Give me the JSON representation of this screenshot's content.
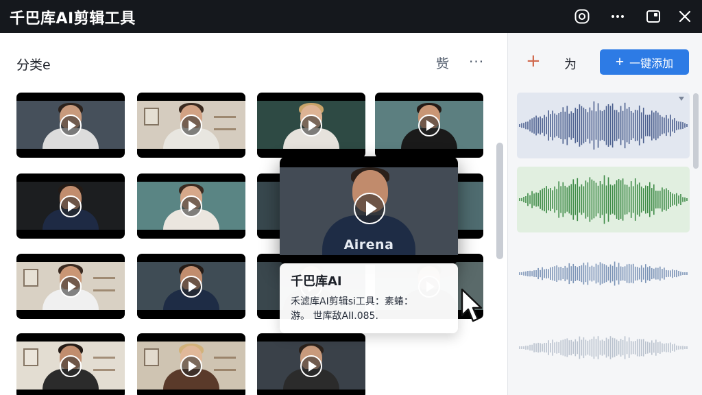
{
  "window": {
    "title": "千巴库AI剪辑工具",
    "controls": [
      "settings-icon",
      "more-icon",
      "restore-icon",
      "close-icon"
    ]
  },
  "library": {
    "category_title": "分类e",
    "header_icon_label": "赀",
    "more_label": "···",
    "thumbnails": [
      {
        "bg": "#46505b",
        "skin": "#c89a7c",
        "hair": "#2c221c",
        "shirt": "#dcdcdc",
        "style": "plain"
      },
      {
        "bg": "#d5ccbf",
        "skin": "#d2a284",
        "hair": "#3a2a20",
        "shirt": "#e8e6e0",
        "style": "room"
      },
      {
        "bg": "#2e4a44",
        "skin": "#ddb394",
        "hair": "#c9a46a",
        "shirt": "#e6e2dc",
        "style": "plain"
      },
      {
        "bg": "#5c7f80",
        "skin": "#c99675",
        "hair": "#241b16",
        "shirt": "#1a1a1a",
        "style": "plain"
      },
      {
        "bg": "#1c1e20",
        "skin": "#c18d6e",
        "hair": "#241b16",
        "shirt": "#1e2a44",
        "style": "plain"
      },
      {
        "bg": "#5a8584",
        "skin": "#d6a88a",
        "hair": "#3a2a20",
        "shirt": "#ebe6df",
        "style": "plain"
      },
      {
        "bg": "#38484e",
        "skin": "#c89a7c",
        "hair": "#2c221c",
        "shirt": "#2a2a2a",
        "style": "plain"
      },
      {
        "bg": "#4f6c70",
        "skin": "#c89a7c",
        "hair": "#2c221c",
        "shirt": "#2a2a2a",
        "style": "plain"
      },
      {
        "bg": "#d9d1c4",
        "skin": "#c99675",
        "hair": "#3a2a20",
        "shirt": "#f0f0f0",
        "style": "room"
      },
      {
        "bg": "#3f4c55",
        "skin": "#c18d6e",
        "hair": "#241b16",
        "shirt": "#1e2c45",
        "style": "plain"
      },
      {
        "bg": "#3a474d",
        "skin": "#c89a7c",
        "hair": "#2c221c",
        "shirt": "#2a2a2a",
        "style": "plain"
      },
      {
        "bg": "#5a6a6a",
        "skin": "#c89a7c",
        "hair": "#2c221c",
        "shirt": "#2a2a2a",
        "style": "plain"
      },
      {
        "bg": "#e3ddd2",
        "skin": "#c18d6e",
        "hair": "#241b16",
        "shirt": "#2b2b2b",
        "style": "room"
      },
      {
        "bg": "#cfc4b2",
        "skin": "#e0b899",
        "hair": "#d2b27a",
        "shirt": "#5a3a2a",
        "style": "room"
      },
      {
        "bg": "#3a4149",
        "skin": "#c89a7c",
        "hair": "#2c221c",
        "shirt": "#2b2b2b",
        "style": "plain"
      }
    ],
    "preview": {
      "shirt_text": "Airena"
    },
    "tooltip": {
      "title": "千巴库AI",
      "line1": "禾滤库AI剪辑si工具：素蝽：",
      "line2": "游。 世库敌AII.085."
    }
  },
  "audio_panel": {
    "add_icon": "+",
    "label": "为",
    "add_button": {
      "icon": "+",
      "label": "一键添加"
    },
    "waveforms": [
      {
        "card_bg": "#e2e7f0",
        "wave_color": "#4b5f8e",
        "amp": 1.0,
        "active": true
      },
      {
        "card_bg": "#e1efe0",
        "wave_color": "#3c8a45",
        "amp": 1.0,
        "active": false
      },
      {
        "card_bg": "#f5f6f8",
        "wave_color": "#7a93b6",
        "amp": 0.5,
        "active": false
      },
      {
        "card_bg": "#f5f6f8",
        "wave_color": "#b9c2ce",
        "amp": 0.5,
        "active": false
      }
    ]
  },
  "colors": {
    "accent": "#2d7be5",
    "titlebar": "#15181d"
  }
}
